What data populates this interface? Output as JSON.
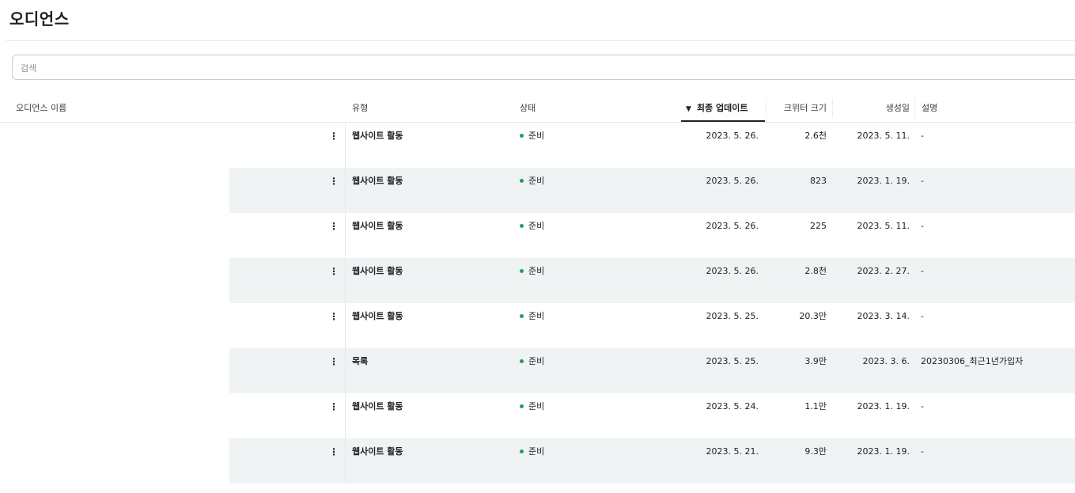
{
  "page": {
    "title": "오디언스"
  },
  "search": {
    "placeholder": "검색",
    "value": ""
  },
  "table": {
    "columns": {
      "name": "오디언스 이름",
      "type": "유형",
      "status": "상태",
      "updated": "최종 업데이트",
      "size": "크위터 크기",
      "created": "생성일",
      "description": "설명"
    },
    "sort": {
      "column": "updated",
      "direction": "descending",
      "icon": "sort-down-triangle-icon"
    },
    "row_menu_glyph": "⋮",
    "status_color": "#1e9e63",
    "rows": [
      {
        "name": "",
        "type": "웹사이트 활동",
        "status": "준비",
        "updated": "2023. 5. 26.",
        "size": "2.6천",
        "created": "2023. 5. 11.",
        "description": "-"
      },
      {
        "name": "",
        "type": "웹사이트 활동",
        "status": "준비",
        "updated": "2023. 5. 26.",
        "size": "823",
        "created": "2023. 1. 19.",
        "description": "-"
      },
      {
        "name": "",
        "type": "웹사이트 활동",
        "status": "준비",
        "updated": "2023. 5. 26.",
        "size": "225",
        "created": "2023. 5. 11.",
        "description": "-"
      },
      {
        "name": "",
        "type": "웹사이트 활동",
        "status": "준비",
        "updated": "2023. 5. 26.",
        "size": "2.8천",
        "created": "2023. 2. 27.",
        "description": "-"
      },
      {
        "name": "",
        "type": "웹사이트 활동",
        "status": "준비",
        "updated": "2023. 5. 25.",
        "size": "20.3만",
        "created": "2023. 3. 14.",
        "description": "-"
      },
      {
        "name": "",
        "type": "목록",
        "status": "준비",
        "updated": "2023. 5. 25.",
        "size": "3.9만",
        "created": "2023. 3. 6.",
        "description": "20230306_최근1년가입자"
      },
      {
        "name": "",
        "type": "웹사이트 활동",
        "status": "준비",
        "updated": "2023. 5. 24.",
        "size": "1.1만",
        "created": "2023. 1. 19.",
        "description": "-"
      },
      {
        "name": "",
        "type": "웹사이트 활동",
        "status": "준비",
        "updated": "2023. 5. 21.",
        "size": "9.3만",
        "created": "2023. 1. 19.",
        "description": "-"
      }
    ]
  }
}
